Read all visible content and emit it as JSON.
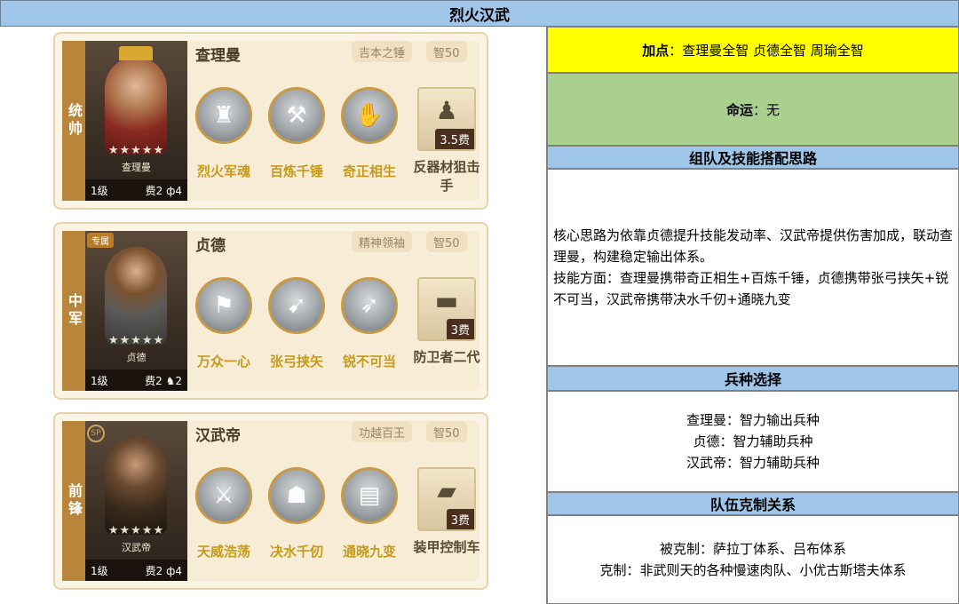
{
  "title": "烈火汉武",
  "cards": [
    {
      "role": "统帅",
      "hero_name": "查理曼",
      "tag": "吉本之锤",
      "intel": "智50",
      "stars": "★★★★★",
      "portrait_name": "查理曼",
      "level": "1级",
      "cost": "费2",
      "unit": "ф4",
      "badge": "",
      "skills": [
        "烈火军魂",
        "百炼千锤",
        "奇正相生"
      ],
      "equip_cost": "3.5费",
      "equip_label": "反器材狙击手"
    },
    {
      "role": "中军",
      "hero_name": "贞德",
      "tag": "精神领袖",
      "intel": "智50",
      "stars": "★★★★★",
      "portrait_name": "贞德",
      "level": "1级",
      "cost": "费2",
      "unit": "♞2",
      "badge": "专属",
      "skills": [
        "万众一心",
        "张弓挟矢",
        "锐不可当"
      ],
      "equip_cost": "3费",
      "equip_label": "防卫者二代"
    },
    {
      "role": "前锋",
      "hero_name": "汉武帝",
      "tag": "功越百王",
      "intel": "智50",
      "stars": "★★★★★",
      "portrait_name": "汉武帝",
      "level": "1级",
      "cost": "费2",
      "unit": "ф4",
      "badge": "SP",
      "skills": [
        "天威浩荡",
        "决水千仞",
        "通晓九变"
      ],
      "equip_cost": "3费",
      "equip_label": "装甲控制车"
    }
  ],
  "right": {
    "points_label": "加点",
    "points_value": "：查理曼全智 贞德全智 周瑜全智",
    "fate_label": "命运",
    "fate_value": "：无",
    "strategy_header": "组队及技能搭配思路",
    "strategy_line1": "核心思路为依靠贞德提升技能发动率、汉武帝提供伤害加成，联动查理曼，构建稳定输出体系。",
    "strategy_line2": "技能方面：查理曼携带奇正相生+百炼千锤，贞德携带张弓挟矢+锐不可当，汉武帝携带决水千仞+通晓九变",
    "troop_header": "兵种选择",
    "troop_lines": [
      "查理曼：智力输出兵种",
      "贞德：智力辅助兵种",
      "汉武帝：智力辅助兵种"
    ],
    "counter_header": "队伍克制关系",
    "counter_lines": [
      "被克制：萨拉丁体系、吕布体系",
      "克制：非武则天的各种慢速肉队、小优古斯塔夫体系"
    ]
  },
  "colors": {
    "header_blue": "#9fc5e8",
    "points_yellow": "#ffff00",
    "fate_green": "#a9d08e",
    "role_strip": "#b8863a",
    "skill_label": "#c79a1a"
  }
}
